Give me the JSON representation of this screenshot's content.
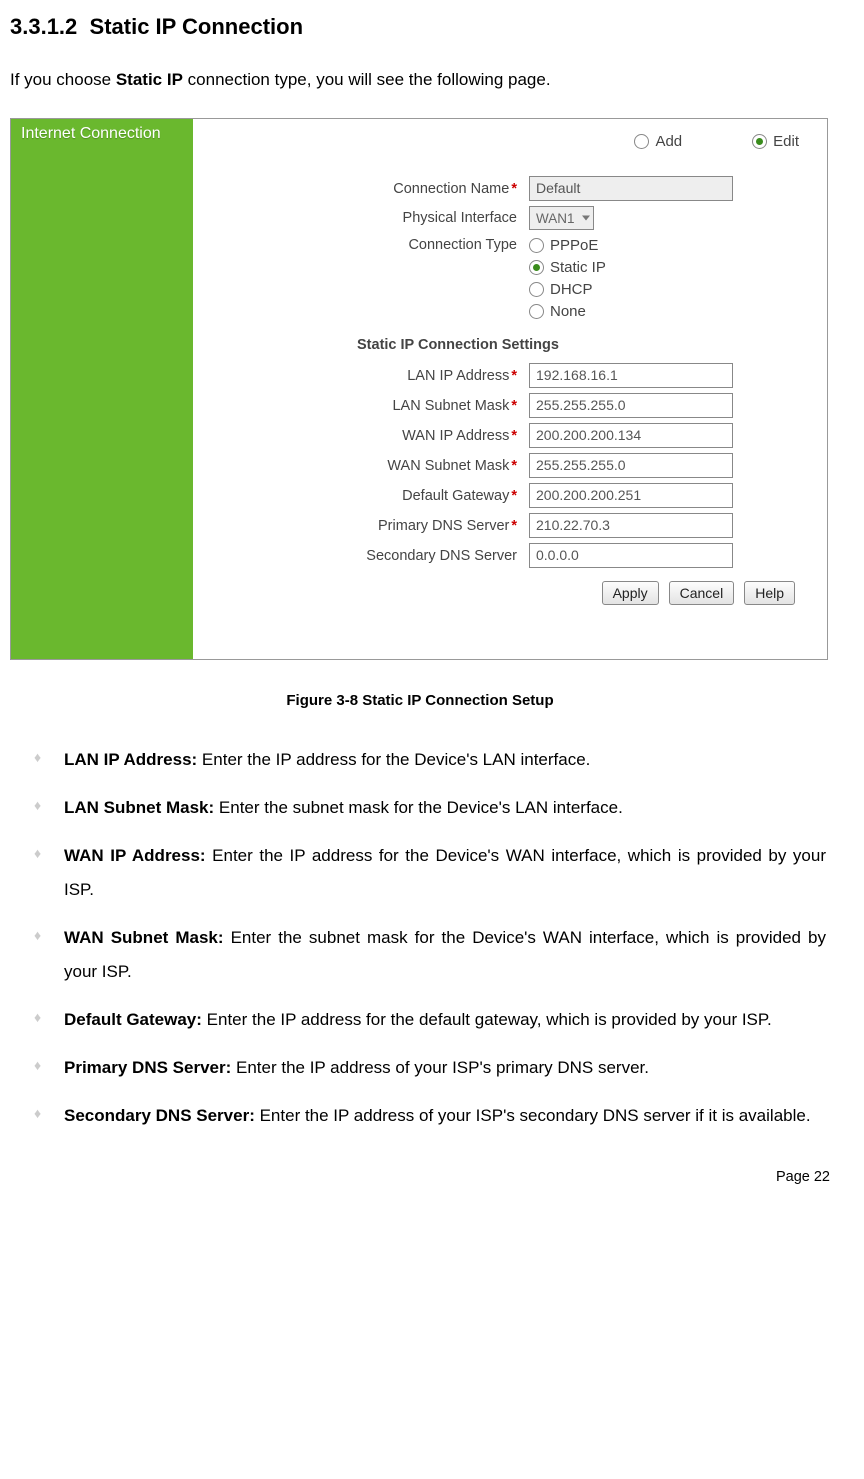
{
  "heading_number": "3.3.1.2",
  "heading_title": "Static IP Connection",
  "intro_prefix": "If you choose ",
  "intro_bold": "Static IP",
  "intro_suffix": " connection type, you will see the following page.",
  "sidebar": {
    "title": "Internet Connection"
  },
  "top_radio": {
    "add": "Add",
    "edit": "Edit",
    "selected": "edit"
  },
  "form": {
    "connection_name": {
      "label": "Connection Name",
      "value": "Default",
      "required": true
    },
    "physical_interface": {
      "label": "Physical Interface",
      "value": "WAN1"
    },
    "connection_type": {
      "label": "Connection Type",
      "options": {
        "pppoe": "PPPoE",
        "static": "Static IP",
        "dhcp": "DHCP",
        "none": "None"
      },
      "selected": "static"
    },
    "section_title": "Static IP Connection Settings",
    "lan_ip": {
      "label": "LAN IP Address",
      "value": "192.168.16.1",
      "required": true
    },
    "lan_mask": {
      "label": "LAN Subnet Mask",
      "value": "255.255.255.0",
      "required": true
    },
    "wan_ip": {
      "label": "WAN IP Address",
      "value": "200.200.200.134",
      "required": true
    },
    "wan_mask": {
      "label": "WAN Subnet Mask",
      "value": "255.255.255.0",
      "required": true
    },
    "gateway": {
      "label": "Default Gateway",
      "value": "200.200.200.251",
      "required": true
    },
    "pri_dns": {
      "label": "Primary DNS Server",
      "value": "210.22.70.3",
      "required": true
    },
    "sec_dns": {
      "label": "Secondary DNS Server",
      "value": "0.0.0.0",
      "required": false
    }
  },
  "buttons": {
    "apply": "Apply",
    "cancel": "Cancel",
    "help": "Help"
  },
  "figure_caption": "Figure 3-8 Static IP Connection Setup",
  "descriptions": {
    "lan_ip": {
      "term": "LAN IP Address:",
      "text": " Enter the IP address for the Device's LAN interface."
    },
    "lan_mask": {
      "term": "LAN Subnet Mask:",
      "text": " Enter the subnet mask for the Device's LAN interface."
    },
    "wan_ip": {
      "term": "WAN IP Address:",
      "text": " Enter the IP address for the Device's WAN interface, which is provided by your ISP."
    },
    "wan_mask": {
      "term": "WAN Subnet Mask:",
      "text": " Enter the subnet mask for the Device's WAN interface, which is provided by your ISP."
    },
    "gateway": {
      "term": "Default Gateway:",
      "text": " Enter the IP address for the default gateway, which is provided by your ISP."
    },
    "pri_dns": {
      "term": "Primary DNS Server:",
      "text": " Enter the IP address of your ISP's primary DNS server."
    },
    "sec_dns": {
      "term": "Secondary DNS Server:",
      "text": " Enter the IP address of your ISP's secondary DNS server if it is available."
    }
  },
  "page_footer": "Page 22"
}
